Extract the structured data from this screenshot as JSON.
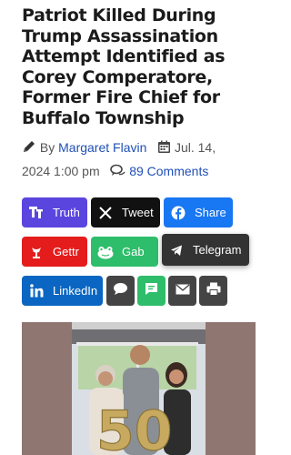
{
  "article": {
    "headline": "Patriot Killed During Trump Assassination Attempt Identified as Corey Comperatore, Former Fire Chief for Buffalo Township",
    "by_label": "By",
    "author": "Margaret Flavin",
    "date_line1": "Jul. 14,",
    "date_line2": "2024 1:00 pm",
    "comments": "89 Comments"
  },
  "share": {
    "truth": "Truth",
    "tweet": "Tweet",
    "share": "Share",
    "gettr": "Gettr",
    "gab": "Gab",
    "telegram": "Telegram",
    "linkedin": "LinkedIn"
  },
  "photo": {
    "balloon_text": "50"
  },
  "icons": {
    "author": "pencil-icon",
    "date": "calendar-icon",
    "comments": "comment-bubbles-icon",
    "truth": "truth-social-icon",
    "tweet": "x-logo-icon",
    "share": "facebook-icon",
    "gettr": "gettr-icon",
    "gab": "gab-frog-icon",
    "telegram": "telegram-plane-icon",
    "linkedin": "linkedin-icon",
    "extra": [
      "speech-bubble-icon",
      "sms-icon",
      "email-icon",
      "print-icon"
    ]
  },
  "colors": {
    "truth": "#5a45df",
    "tweet": "#111111",
    "facebook": "#1877f2",
    "gettr": "#e41c1c",
    "gab": "#2ebd6b",
    "telegram": "#333333",
    "linkedin": "#0a66c2",
    "comment_btn": "#444444",
    "sms_btn": "#2ebd6b",
    "email_btn": "#444444",
    "print_btn": "#444444",
    "link": "#1f4fb8"
  }
}
